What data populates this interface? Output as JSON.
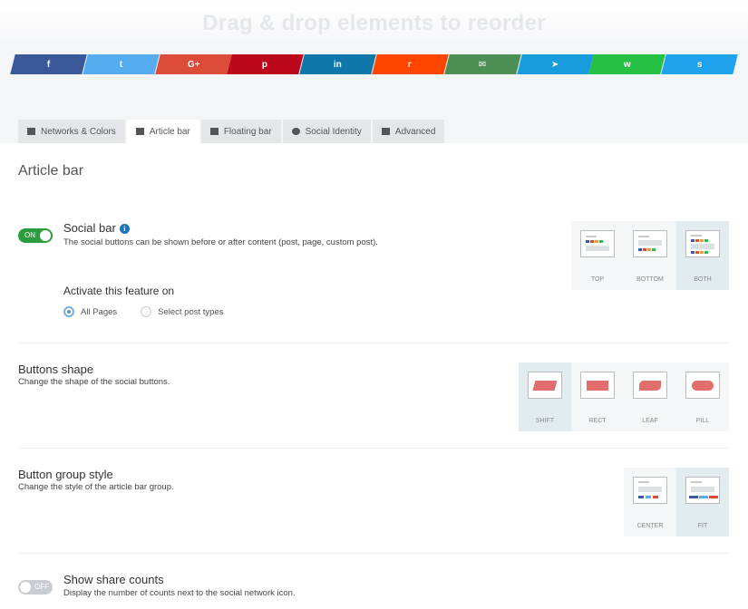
{
  "header": {
    "drag_title": "Drag & drop elements to reorder"
  },
  "social_networks": [
    {
      "name": "facebook",
      "glyph": "f",
      "color": "#3b5998"
    },
    {
      "name": "twitter",
      "glyph": "t",
      "color": "#55acee"
    },
    {
      "name": "google-plus",
      "glyph": "G+",
      "color": "#dd4b39"
    },
    {
      "name": "pinterest",
      "glyph": "p",
      "color": "#bd081c"
    },
    {
      "name": "linkedin",
      "glyph": "in",
      "color": "#0e76a8"
    },
    {
      "name": "reddit",
      "glyph": "r",
      "color": "#ff4500"
    },
    {
      "name": "email",
      "glyph": "✉",
      "color": "#4c8f54"
    },
    {
      "name": "telegram",
      "glyph": "➤",
      "color": "#179cde"
    },
    {
      "name": "whatsapp",
      "glyph": "w",
      "color": "#25c044"
    },
    {
      "name": "skype",
      "glyph": "s",
      "color": "#1fa3ec"
    }
  ],
  "tabs": [
    {
      "label": "Networks & Colors",
      "icon": "image-icon",
      "active": false
    },
    {
      "label": "Article bar",
      "icon": "article-icon",
      "active": true
    },
    {
      "label": "Floating bar",
      "icon": "floating-icon",
      "active": false
    },
    {
      "label": "Social Identity",
      "icon": "share-icon",
      "active": false
    },
    {
      "label": "Advanced",
      "icon": "advanced-icon",
      "active": false
    }
  ],
  "section_title": "Article bar",
  "social_bar": {
    "title": "Social bar",
    "description": "The social buttons can be shown before or after content (post, page, custom post).",
    "toggle": "ON",
    "activate_label": "Activate this feature on",
    "radio_options": [
      "All Pages",
      "Select post types"
    ],
    "radio_selected": "All Pages",
    "positions": [
      "TOP",
      "BOTTOM",
      "BOTH"
    ],
    "position_selected": "BOTH"
  },
  "buttons_shape": {
    "title": "Buttons shape",
    "description": "Change the shape of the social buttons.",
    "options": [
      "SHIFT",
      "RECT",
      "LEAF",
      "PILL"
    ],
    "selected": "SHIFT"
  },
  "button_group_style": {
    "title": "Button group style",
    "description": "Change the style of the article bar group.",
    "options": [
      "CENTER",
      "FIT"
    ],
    "selected": "FIT"
  },
  "share_counts": {
    "title": "Show share counts",
    "description": "Display the number of counts next to the social network icon.",
    "toggle": "OFF"
  },
  "colors": {
    "toggle_on": "#2c9c3e",
    "info": "#1f73b7",
    "shape": "#e26d6d"
  }
}
